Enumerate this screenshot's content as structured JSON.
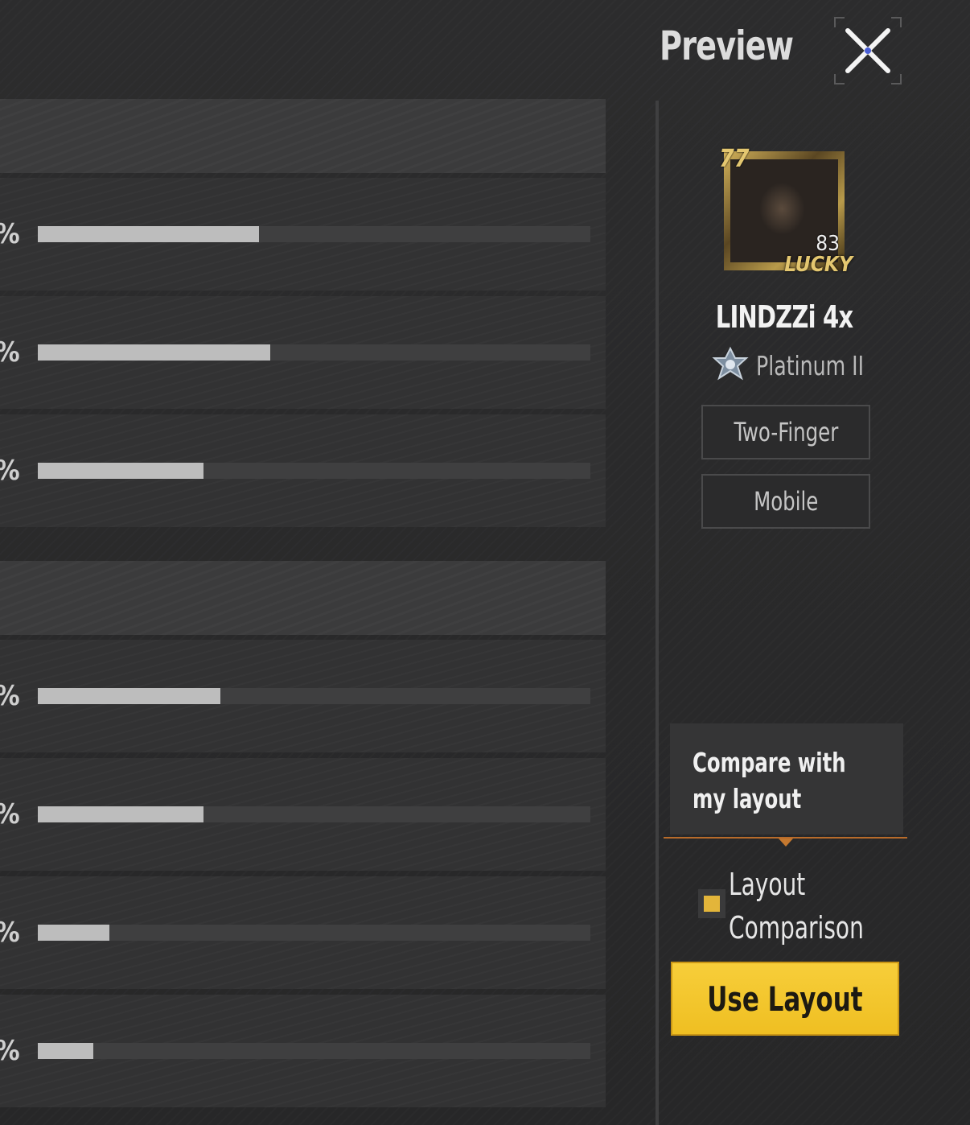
{
  "header": {
    "title": "Preview",
    "close_icon": "close-icon"
  },
  "stats": {
    "group1": [
      {
        "label": "%",
        "fill_fraction": 0.4
      },
      {
        "label": "%",
        "fill_fraction": 0.42
      },
      {
        "label": "%",
        "fill_fraction": 0.3
      }
    ],
    "group2": [
      {
        "label": "%",
        "fill_fraction": 0.33
      },
      {
        "label": "%",
        "fill_fraction": 0.3
      },
      {
        "label": "%",
        "fill_fraction": 0.13
      },
      {
        "label": "%",
        "fill_fraction": 0.1
      }
    ]
  },
  "profile": {
    "avatar_tag": "77",
    "avatar_level": "83",
    "avatar_badge": "LUCKY",
    "name": "LINDZZi  4x",
    "tier_icon": "platinum-tier-icon",
    "tier": "Platinum II",
    "tags": [
      "Two-Finger",
      "Mobile"
    ]
  },
  "compare": {
    "tooltip": "Compare with my layout",
    "toggle_label_line1": "Layout",
    "toggle_label_line2": "Comparison",
    "toggle_on": true
  },
  "actions": {
    "use_layout": "Use Layout"
  },
  "colors": {
    "accent": "#f2c12e",
    "bar_fill": "#bdbdbd",
    "bar_track": "#3f3f40",
    "background": "#2a2a2b"
  }
}
